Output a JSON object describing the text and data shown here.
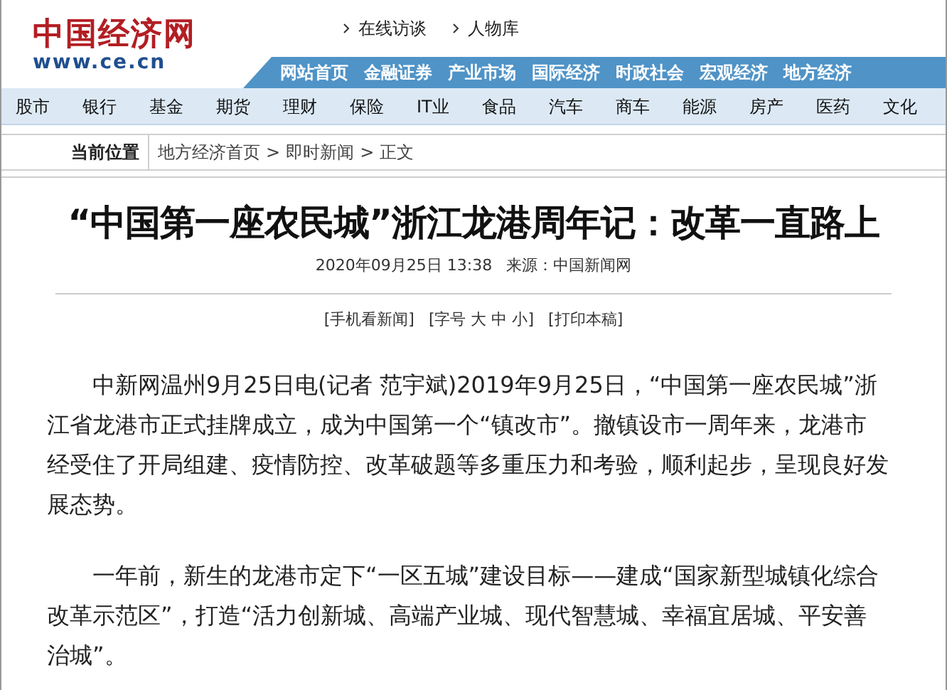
{
  "logo": {
    "name": "中国经济网",
    "url": "www.ce.cn"
  },
  "top_links": [
    "在线访谈",
    "人物库"
  ],
  "main_nav": [
    "网站首页",
    "金融证券",
    "产业市场",
    "国际经济",
    "时政社会",
    "宏观经济",
    "地方经济"
  ],
  "sub_nav": [
    "股市",
    "银行",
    "基金",
    "期货",
    "理财",
    "保险",
    "IT业",
    "食品",
    "汽车",
    "商车",
    "能源",
    "房产",
    "医药",
    "文化"
  ],
  "breadcrumb": {
    "label": "当前位置",
    "items": [
      "地方经济首页",
      "即时新闻",
      "正文"
    ],
    "separator": ">"
  },
  "article": {
    "title": "“中国第一座农民城”浙江龙港周年记：改革一直路上",
    "date": "2020年09月25日 13:38",
    "source": "来源：中国新闻网",
    "tools": [
      "[手机看新闻]",
      "[字号 大 中 小]",
      "[打印本稿]"
    ],
    "paragraphs": [
      "中新网温州9月25日电(记者 范宇斌)2019年9月25日，“中国第一座农民城”浙江省龙港市正式挂牌成立，成为中国第一个“镇改市”。撤镇设市一周年来，龙港市经受住了开局组建、疫情防控、改革破题等多重压力和考验，顺利起步，呈现良好发展态势。",
      "一年前，新生的龙港市定下“一区五城”建设目标——建成“国家新型城镇化综合改革示范区”，打造“活力创新城、高端产业城、现代智慧城、幸福宜居城、平安善治城”。"
    ]
  }
}
